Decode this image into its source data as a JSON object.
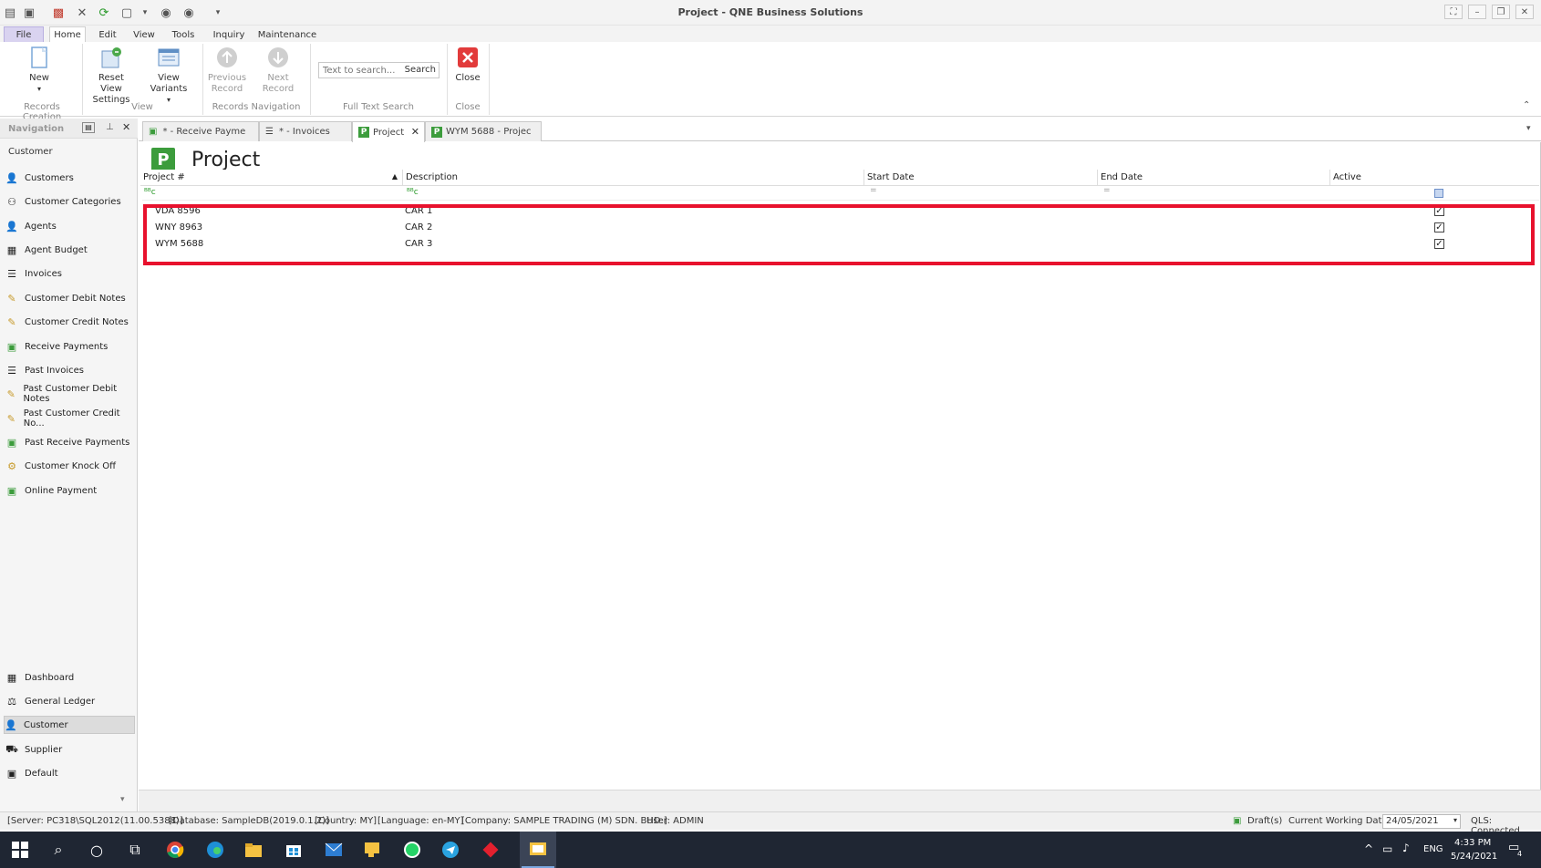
{
  "window": {
    "title": "Project - QNE Business Solutions"
  },
  "menu_tabs": [
    "File",
    "Home",
    "Edit",
    "View",
    "Tools",
    "Inquiry",
    "Maintenance"
  ],
  "ribbon": {
    "new_label": "New",
    "reset_view_label_1": "Reset View",
    "reset_view_label_2": "Settings",
    "view_variants_label": "View Variants",
    "previous_record_label_1": "Previous",
    "previous_record_label_2": "Record",
    "next_record_label": "Next Record",
    "search_placeholder": "Text to search...",
    "search_button": "Search",
    "close_label": "Close",
    "groups": {
      "records_creation": "Records Creation",
      "view": "View",
      "records_navigation": "Records Navigation",
      "full_text_search": "Full Text Search",
      "close": "Close"
    }
  },
  "navigation": {
    "title": "Navigation",
    "section": "Customer",
    "items": [
      "Customers",
      "Customer Categories",
      "Agents",
      "Agent Budget",
      "Invoices",
      "Customer Debit Notes",
      "Customer Credit Notes",
      "Receive Payments",
      "Past Invoices",
      "Past Customer Debit Notes",
      "Past Customer Credit No...",
      "Past Receive Payments",
      "Customer Knock Off",
      "Online Payment"
    ],
    "modules": [
      "Dashboard",
      "General Ledger",
      "Customer",
      "Supplier",
      "Default"
    ],
    "selected_module": "Customer"
  },
  "doc_tabs": [
    {
      "label": "* - Receive Payme"
    },
    {
      "label": "* - Invoices"
    },
    {
      "label": "Project"
    },
    {
      "label": "WYM 5688 - Projec"
    }
  ],
  "page": {
    "title": "Project",
    "columns": [
      "Project #",
      "Description",
      "Start Date",
      "End Date",
      "Active"
    ],
    "filter_marker": "ᴮᴮc",
    "rows": [
      {
        "project_no": "VDA 8596",
        "description": "CAR 1",
        "start_date": "",
        "end_date": "",
        "active": true
      },
      {
        "project_no": "WNY 8963",
        "description": "CAR 2",
        "start_date": "",
        "end_date": "",
        "active": true
      },
      {
        "project_no": "WYM 5688",
        "description": "CAR 3",
        "start_date": "",
        "end_date": "",
        "active": true
      }
    ]
  },
  "status": {
    "server": "[Server: PC318\\SQL2012(11.00.5388)]",
    "database": "[Database: SampleDB(2019.0.1.2)]",
    "country": "[Country: MY]",
    "language": "[Language: en-MY]",
    "company": "[Company: SAMPLE TRADING (M) SDN. BHD.]",
    "user": "User: ADMIN",
    "drafts": "Draft(s)",
    "working_date_label": "Current Working Date:",
    "working_date": "24/05/2021",
    "qls": "QLS: Connected"
  },
  "taskbar": {
    "lang": "ENG",
    "time": "4:33 PM",
    "date": "5/24/2021",
    "notification_count": "4"
  },
  "colors": {
    "highlight": "#e8112d",
    "project_green": "#3c9c3c",
    "taskbar": "#1f2633"
  }
}
